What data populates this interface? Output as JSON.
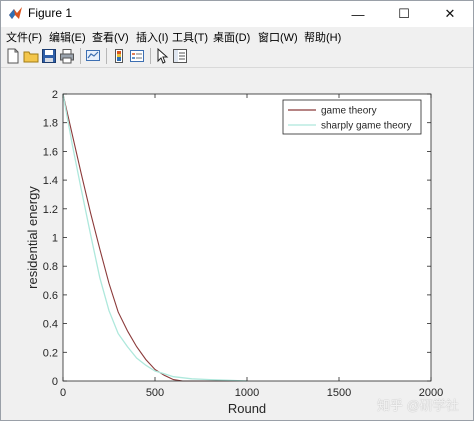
{
  "window": {
    "title": "Figure 1",
    "controls": {
      "minimize": "—",
      "maximize": "☐",
      "close": "✕"
    }
  },
  "menu": {
    "items": [
      "文件(F)",
      "编辑(E)",
      "查看(V)",
      "插入(I)",
      "工具(T)",
      "桌面(D)",
      "窗口(W)",
      "帮助(H)"
    ]
  },
  "toolbar": {
    "icons": [
      "new-figure-icon",
      "open-file-icon",
      "save-icon",
      "print-icon",
      "link-plot-icon",
      "insert-colorbar-icon",
      "insert-legend-icon",
      "select-arrow-icon",
      "property-inspector-icon"
    ]
  },
  "watermark": "知乎 @研学社",
  "colors": {
    "series_game_theory": "#8b3a3a",
    "series_sharply": "#aee8dc"
  },
  "chart_data": {
    "type": "line",
    "title": "",
    "xlabel": "Round",
    "ylabel": "residential energy",
    "xlim": [
      0,
      2000
    ],
    "ylim": [
      0,
      2
    ],
    "xticks": [
      "0",
      "500",
      "1000",
      "1500",
      "2000"
    ],
    "yticks": [
      "0",
      "0.2",
      "0.4",
      "0.6",
      "0.8",
      "1",
      "1.2",
      "1.4",
      "1.6",
      "1.8",
      "2"
    ],
    "grid": false,
    "legend_position": "top-right",
    "series": [
      {
        "name": "game theory",
        "x": [
          0,
          50,
          100,
          150,
          200,
          250,
          300,
          350,
          400,
          450,
          500,
          550,
          600,
          650,
          700,
          1000
        ],
        "values": [
          2.0,
          1.72,
          1.44,
          1.17,
          0.92,
          0.68,
          0.48,
          0.35,
          0.24,
          0.15,
          0.08,
          0.04,
          0.01,
          0.0,
          0.0,
          0.0
        ]
      },
      {
        "name": "sharply game theory",
        "x": [
          0,
          50,
          100,
          150,
          200,
          250,
          300,
          350,
          400,
          450,
          500,
          550,
          600,
          700,
          800,
          900,
          1000
        ],
        "values": [
          2.0,
          1.65,
          1.33,
          1.02,
          0.72,
          0.49,
          0.33,
          0.24,
          0.16,
          0.11,
          0.07,
          0.05,
          0.03,
          0.015,
          0.01,
          0.005,
          0.0
        ]
      }
    ]
  }
}
